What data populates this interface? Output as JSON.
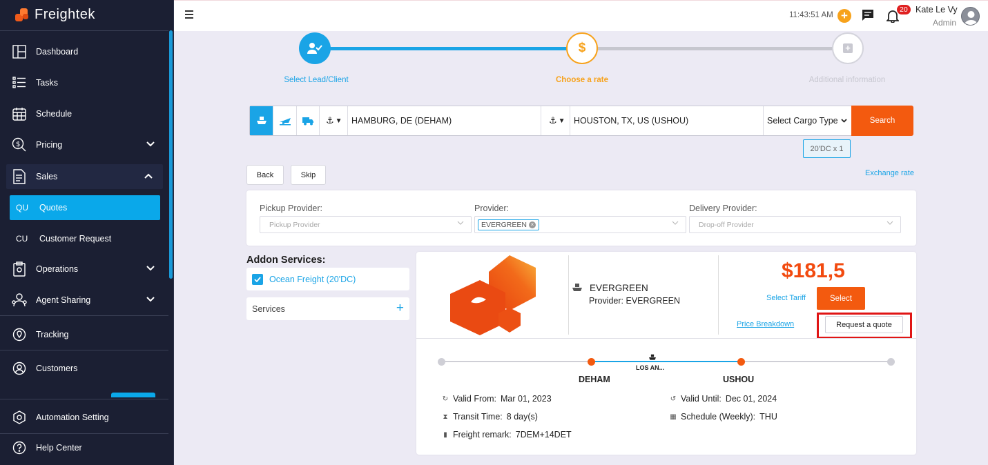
{
  "app": {
    "name": "Freightek"
  },
  "sidebar": {
    "items": [
      {
        "label": "Dashboard"
      },
      {
        "label": "Tasks"
      },
      {
        "label": "Schedule"
      },
      {
        "label": "Pricing"
      },
      {
        "label": "Sales"
      },
      {
        "label": "Operations"
      },
      {
        "label": "Agent Sharing"
      },
      {
        "label": "Tracking"
      },
      {
        "label": "Customers"
      },
      {
        "label": "Automation Setting"
      },
      {
        "label": "Help Center"
      }
    ],
    "sales_sub": [
      {
        "code": "QU",
        "label": "Quotes"
      },
      {
        "code": "CU",
        "label": "Customer Request"
      }
    ]
  },
  "header": {
    "time": "11:43:51 AM",
    "notifications": "20",
    "user_name": "Kate Le Vy",
    "user_role": "Admin"
  },
  "stepper": {
    "steps": [
      {
        "label": "Select Lead/Client"
      },
      {
        "label": "Choose a rate"
      },
      {
        "label": "Additional information"
      }
    ]
  },
  "search": {
    "origin": "HAMBURG, DE (DEHAM)",
    "destination": "HOUSTON, TX, US (USHOU)",
    "cargo_type": "Select Cargo Type",
    "button": "Search",
    "container_tag": "20'DC x 1"
  },
  "actions": {
    "back": "Back",
    "skip": "Skip",
    "exchange_rate": "Exchange rate"
  },
  "providers": {
    "pickup_label": "Pickup Provider:",
    "pickup_placeholder": "Pickup Provider",
    "provider_label": "Provider:",
    "provider_chip": "EVERGREEN",
    "delivery_label": "Delivery Provider:",
    "delivery_placeholder": "Drop-off Provider"
  },
  "addons": {
    "title": "Addon Services:",
    "ocean_freight": "Ocean Freight (20'DC)",
    "services": "Services"
  },
  "rate": {
    "carrier": "EVERGREEN",
    "provider": "Provider: EVERGREEN",
    "price": "$181,5",
    "select_tariff": "Select Tariff",
    "select": "Select",
    "price_breakdown": "Price Breakdown",
    "request_quote": "Request a quote",
    "origin_port": "DEHAM",
    "via": "LOS AN...",
    "destination_port": "USHOU",
    "valid_from_label": "Valid From:",
    "valid_from": "Mar 01, 2023",
    "valid_until_label": "Valid Until:",
    "valid_until": "Dec 01, 2024",
    "transit_label": "Transit Time:",
    "transit": "8 day(s)",
    "schedule_label": "Schedule (Weekly):",
    "schedule": "THU",
    "remark_label": "Freight remark:",
    "remark": "7DEM+14DET"
  },
  "colors": {
    "accent": "#1aa4e6",
    "orange": "#f35a0f",
    "sidebar": "#1b1f33",
    "stepper_active": "#f7a21b"
  }
}
